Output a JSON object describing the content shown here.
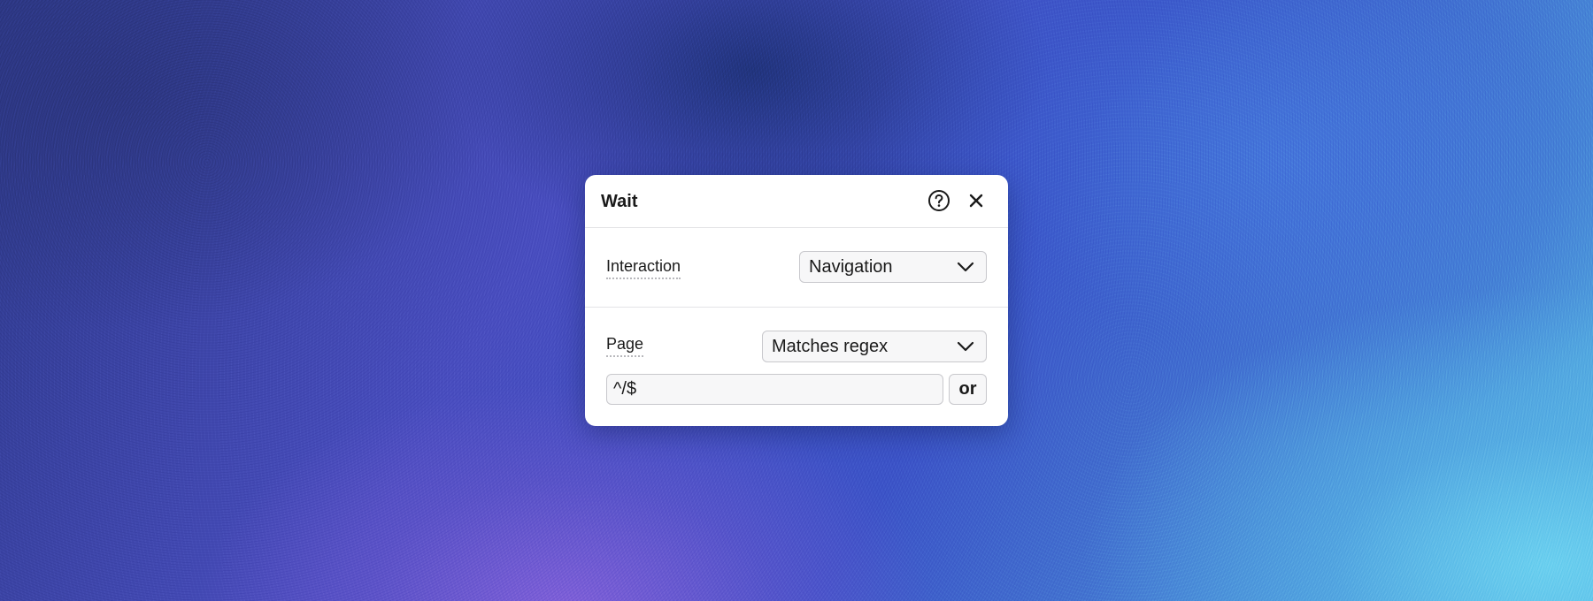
{
  "dialog": {
    "title": "Wait",
    "help_icon": "question-circle-icon",
    "close_icon": "close-icon"
  },
  "interaction": {
    "label": "Interaction",
    "selected": "Navigation"
  },
  "page": {
    "label": "Page",
    "match_mode": "Matches regex",
    "pattern": "^/$",
    "or_label": "or"
  },
  "colors": {
    "dialog_bg": "#ffffff",
    "field_bg": "#f7f7f8",
    "border": "#c8c8cc",
    "text": "#1a1a1a"
  }
}
